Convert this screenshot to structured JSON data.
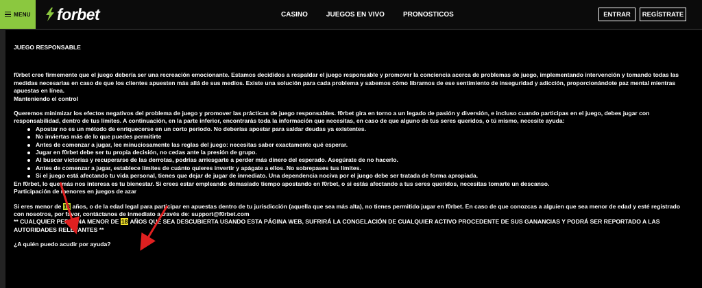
{
  "header": {
    "menu_label": "MENU",
    "logo_text": "forbet",
    "nav": [
      "CASINO",
      "JUEGOS EN VIVO",
      "PRONOSTICOS"
    ],
    "login_label": "ENTRAR",
    "register_label": "REGÍSTRATE"
  },
  "colors": {
    "accent": "#8bc83f",
    "highlight": "#c8dd34",
    "arrow": "#e02020"
  },
  "icons": [
    "hamburger-icon",
    "lightning-bolt-icon",
    "red-arrow-icon"
  ],
  "content": {
    "title": "JUEGO RESPONSABLE",
    "p1": "f0rbet cree firmemente que el juego debería ser una recreación emocionante. Estamos decididos a respaldar el juego responsable y promover la conciencia acerca de problemas de juego, implementando intervención y tomando todas las medidas necesarias en caso de que los clientes apuesten más allá de sus medios. Existe una solución para cada problema y sabemos cómo librarnos de ese sentimiento de inseguridad y adicción, proporcionándote paz mental mientras apuestas en línea.",
    "p1b": "Manteniendo el control",
    "p2": "Queremos minimizar los efectos negativos del problema de juego y promover las prácticas de juego responsables. f0rbet gira en torno a un legado de pasión y diversión, e incluso cuando participas en el juego, debes jugar con responsabilidad, dentro de tus límites. A continuación, en la parte inferior, encontrarás toda la información que necesitas, en caso de que alguno de tus seres queridos, o tú mismo, necesite ayuda:",
    "bullets": [
      "Apostar no es un método de enriquecerse en un corto periodo. No deberías apostar para saldar deudas ya existentes.",
      "No inviertas más de lo que puedes permitirte",
      "Antes de comenzar a jugar, lee minuciosamente las reglas del juego: necesitas saber exactamente qué esperar.",
      "Jugar en f0rbet debe ser tu propia decisión, no cedas ante la presión de grupo.",
      "Al buscar victorias y recuperarse de las derrotas, podrías arriesgarte a perder más dinero del esperado. Asegúrate de no hacerlo.",
      "Antes de comenzar a jugar, establece límites de cuánto quieres invertir y apágate a ellos. No sobrepases tus límites.",
      "Si el juego está afectando tu vida personal, tienes que dejar de jugar de inmediato. Una dependencia nociva por el juego debe ser tratada de forma apropiada."
    ],
    "p3": "En f0rbet, lo que más nos interesa es tu bienestar. Si crees estar empleando demasiado tiempo apostando en f0rbet, o si estás afectando a tus seres queridos, necesitas tomarte un descanso.",
    "p4": "Participación de menores en juegos de azar",
    "p5_pre": "Si eres menor de ",
    "p5_num": "18",
    "p5_post": " años, o de la edad legal para participar en apuestas dentro de tu jurisdicción (aquella que sea más alta), no tienes permitido jugar en f0rbet. En caso de que conozcas a alguien que sea menor de edad y esté registrado con nosotros, por favor, contáctanos de inmediato a través de: support@f0rbet.com",
    "p6_pre": "** CUALQUIER PERSONA MENOR DE ",
    "p6_num": "18",
    "p6_post": " AÑOS QUE SEA DESCUBIERTA USANDO ESTA PÁGINA WEB, SUFRIRÁ LA CONGELACIÓN DE CUALQUIER ACTIVO PROCEDENTE DE SUS GANANCIAS Y PODRÁ SER REPORTADO A LAS AUTORIDADES RELEVANTES **",
    "p7": "¿A quién puedo acudir por ayuda?"
  }
}
